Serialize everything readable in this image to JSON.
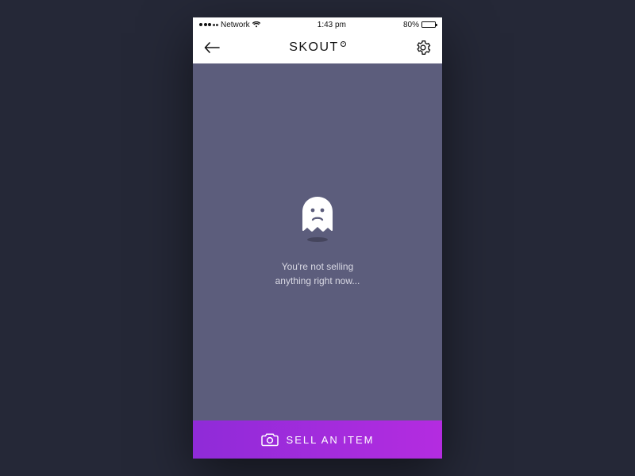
{
  "statusbar": {
    "carrier": "Network",
    "time": "1:43 pm",
    "battery_pct": "80%"
  },
  "header": {
    "title": "SKOUT"
  },
  "empty_state": {
    "line1": "You're not selling",
    "line2": "anything right now..."
  },
  "cta": {
    "label": "SELL AN ITEM"
  },
  "colors": {
    "content_bg": "#5c5d7c",
    "cta_start": "#8f2bd8",
    "cta_end": "#b42ce0"
  }
}
